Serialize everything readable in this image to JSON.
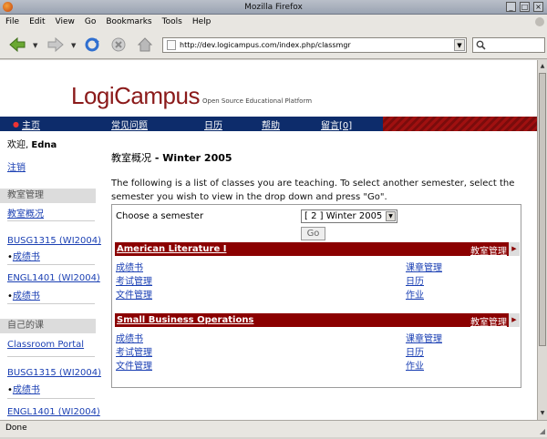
{
  "window": {
    "title": "Mozilla Firefox"
  },
  "menu": [
    "File",
    "Edit",
    "View",
    "Go",
    "Bookmarks",
    "Tools",
    "Help"
  ],
  "toolbar": {
    "url": "http://dev.logicampus.com/index.php/classmgr"
  },
  "site": {
    "logo": "LogiCampus",
    "tagline": "Open Source Educational Platform"
  },
  "tabs": [
    {
      "label": "主页"
    },
    {
      "label": "常见问题"
    },
    {
      "label": "日历"
    },
    {
      "label": "帮助"
    },
    {
      "label": "留言[0]"
    }
  ],
  "sidebar": {
    "greeting_prefix": "欢迎, ",
    "user": "Edna",
    "logout": "注销",
    "classroom_header": "教室管理",
    "classroom_overview": "教室概况",
    "teaching": [
      {
        "course": "BUSG1315 (WI2004)",
        "sub": "成绩书"
      },
      {
        "course": "ENGL1401 (WI2004)",
        "sub": "成绩书"
      }
    ],
    "my_classes_header": "自己的课",
    "portal": "Classroom Portal",
    "enrolled": [
      {
        "course": "BUSG1315 (WI2004)",
        "sub": "成绩书"
      },
      {
        "course": "ENGL1401 (WI2004)"
      }
    ]
  },
  "main": {
    "heading_prefix": "教室概况",
    "heading_suffix": " - Winter 2005",
    "intro": "The following is a list of classes you are teaching. To select another semester, select the semester you wish to view in the drop down and press \"Go\".",
    "semester_label": "Choose a semester",
    "semester_value": "[ 2 ] Winter 2005",
    "go_label": "Go",
    "classes": [
      {
        "name": "American Literature I",
        "manage": "教室管理",
        "left_links": [
          "成绩书",
          "考试管理",
          "文件管理"
        ],
        "right_links": [
          "课章管理",
          "日历",
          "作业"
        ]
      },
      {
        "name": "Small Business Operations",
        "manage": "教室管理",
        "left_links": [
          "成绩书",
          "考试管理",
          "文件管理"
        ],
        "right_links": [
          "课章管理",
          "日历",
          "作业"
        ]
      }
    ]
  },
  "status": {
    "text": "Done"
  }
}
